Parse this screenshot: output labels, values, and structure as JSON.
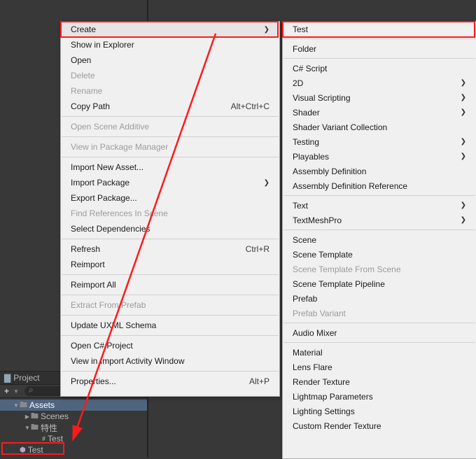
{
  "project": {
    "tab_label": "Project",
    "tree": {
      "assets": "Assets",
      "scenes": "Scenes",
      "tex": "特性",
      "test_folder": "Test",
      "test_script": "Test"
    }
  },
  "menuA": {
    "create": "Create",
    "show_in_explorer": "Show in Explorer",
    "open": "Open",
    "delete": "Delete",
    "rename": "Rename",
    "copy_path": "Copy Path",
    "copy_path_sc": "Alt+Ctrl+C",
    "open_scene_additive": "Open Scene Additive",
    "view_pkg": "View in Package Manager",
    "import_new": "Import New Asset...",
    "import_pkg": "Import Package",
    "export_pkg": "Export Package...",
    "find_refs": "Find References In Scene",
    "select_deps": "Select Dependencies",
    "refresh": "Refresh",
    "refresh_sc": "Ctrl+R",
    "reimport": "Reimport",
    "reimport_all": "Reimport All",
    "extract_prefab": "Extract From Prefab",
    "update_uxml": "Update UXML Schema",
    "open_cs": "Open C# Project",
    "view_import": "View in Import Activity Window",
    "properties": "Properties...",
    "properties_sc": "Alt+P"
  },
  "menuB": {
    "test": "Test",
    "folder": "Folder",
    "csharp": "C# Script",
    "twod": "2D",
    "visualscript": "Visual Scripting",
    "shader": "Shader",
    "shader_variant": "Shader Variant Collection",
    "testing": "Testing",
    "playables": "Playables",
    "asm_def": "Assembly Definition",
    "asm_ref": "Assembly Definition Reference",
    "text": "Text",
    "tmp": "TextMeshPro",
    "scene": "Scene",
    "scene_tmpl": "Scene Template",
    "scene_tmpl_from": "Scene Template From Scene",
    "scene_tmpl_pipe": "Scene Template Pipeline",
    "prefab": "Prefab",
    "prefab_variant": "Prefab Variant",
    "audio_mixer": "Audio Mixer",
    "material": "Material",
    "lens_flare": "Lens Flare",
    "render_tex": "Render Texture",
    "lightmap": "Lightmap Parameters",
    "lighting": "Lighting Settings",
    "custom_rt": "Custom Render Texture"
  }
}
